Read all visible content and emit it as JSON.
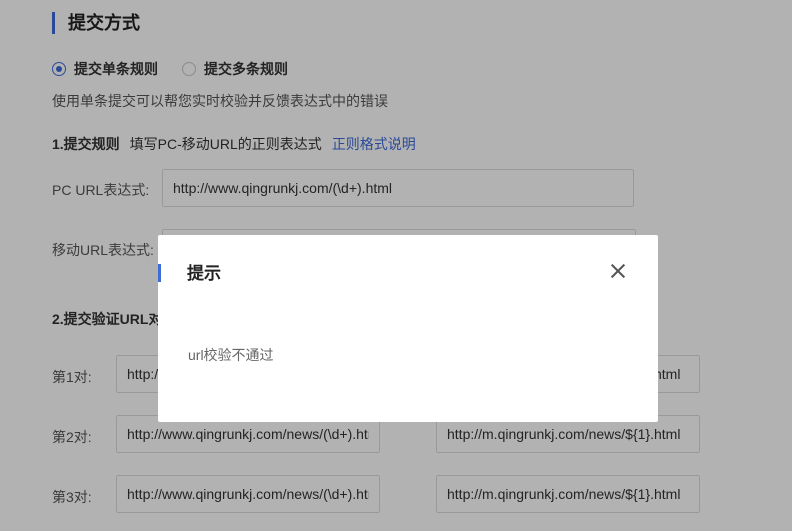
{
  "section_title": "提交方式",
  "radios": [
    {
      "label": "提交单条规则",
      "checked": true
    },
    {
      "label": "提交多条规则",
      "checked": false
    }
  ],
  "description": "使用单条提交可以帮您实时校验并反馈表达式中的错误",
  "step1": {
    "title": "1.提交规则",
    "hint": "填写PC-移动URL的正则表达式",
    "link": "正则格式说明"
  },
  "pc_url": {
    "label": "PC  URL表达式:",
    "value": "http://www.qingrunkj.com/(\\d+).html"
  },
  "mobile_url": {
    "label": "移动URL表达式:",
    "value": ""
  },
  "step2": {
    "title": "2.提交验证URL对"
  },
  "pairs": [
    {
      "label": "第1对:",
      "pc": "http://www.qingrunkj.com/news/(\\d+).html",
      "mobile": "http://m.qingrunkj.com/news/${1}.html"
    },
    {
      "label": "第2对:",
      "pc": "http://www.qingrunkj.com/news/(\\d+).html",
      "mobile": "http://m.qingrunkj.com/news/${1}.html"
    },
    {
      "label": "第3对:",
      "pc": "http://www.qingrunkj.com/news/(\\d+).html",
      "mobile": "http://m.qingrunkj.com/news/${1}.html"
    }
  ],
  "dialog": {
    "title": "提示",
    "message": "url校验不通过"
  },
  "colors": {
    "accent": "#3d6bd8",
    "overlay": "rgba(0,0,0,0.30)"
  }
}
